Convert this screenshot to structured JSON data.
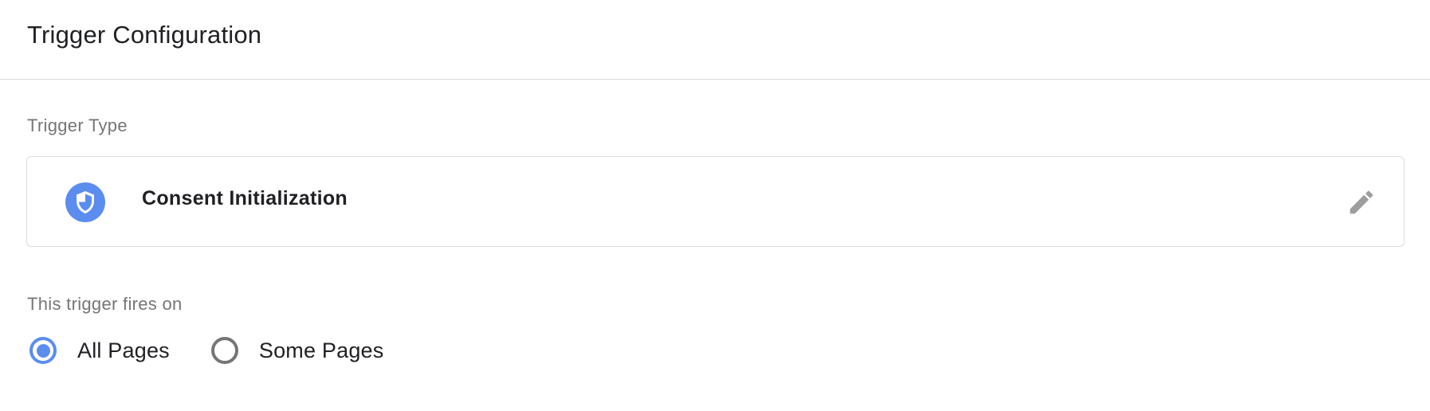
{
  "header": {
    "title": "Trigger Configuration"
  },
  "trigger_type": {
    "section_label": "Trigger Type",
    "name": "Consent Initialization",
    "icon": "shield-icon",
    "icon_color": "#5b8def",
    "edit_icon": "pencil-icon"
  },
  "fires_on": {
    "section_label": "This trigger fires on",
    "options": [
      {
        "label": "All Pages",
        "selected": true
      },
      {
        "label": "Some Pages",
        "selected": false
      }
    ],
    "accent_color": "#5b8def"
  }
}
